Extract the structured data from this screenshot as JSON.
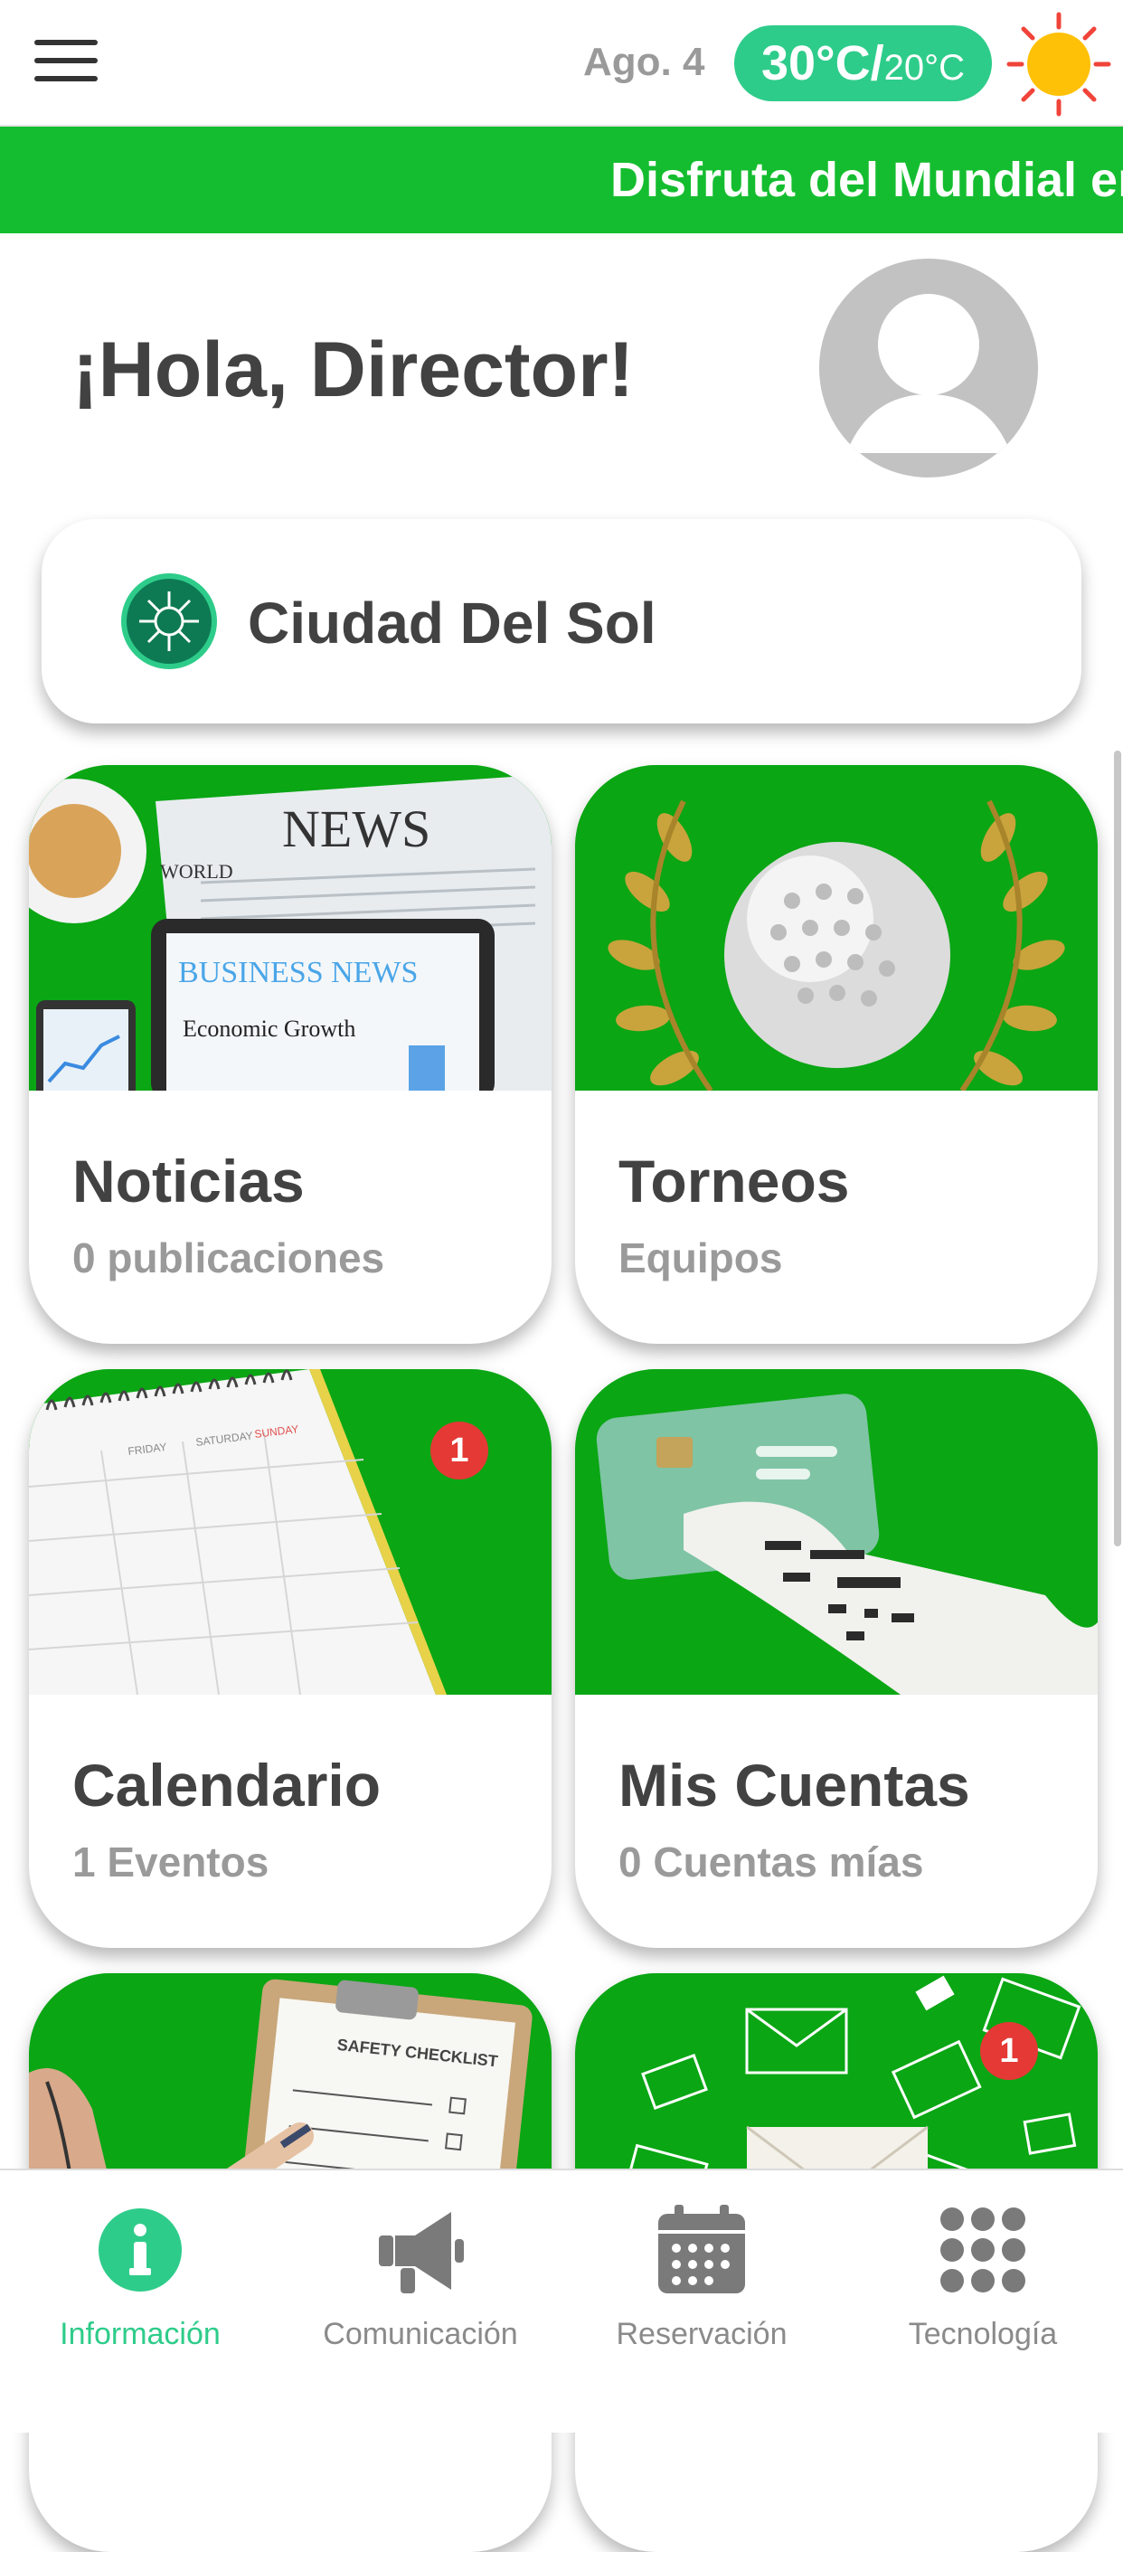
{
  "header": {
    "date": "Ago. 4",
    "temp_high": "30°C/",
    "temp_low": "20°C"
  },
  "ticker": {
    "text": "Disfruta del Mundial en"
  },
  "greeting": "¡Hola, Director!",
  "club": {
    "name": "Ciudad Del Sol"
  },
  "tiles": [
    {
      "title": "Noticias",
      "subtitle": "0 publicaciones",
      "image_text": [
        "NEWS",
        "WORLD",
        "BUSINESS NEWS",
        "Economic Growth"
      ]
    },
    {
      "title": "Torneos",
      "subtitle": "Equipos"
    },
    {
      "title": "Calendario",
      "subtitle": "1 Eventos",
      "badge": "1",
      "image_text": [
        "FRIDAY",
        "SATURDAY",
        "SUNDAY"
      ]
    },
    {
      "title": "Mis Cuentas",
      "subtitle": "0 Cuentas mías"
    },
    {
      "image_text": [
        "SAFETY CHECKLIST"
      ]
    },
    {
      "badge": "1"
    }
  ],
  "nav": [
    {
      "label": "Información",
      "icon": "info-icon",
      "active": true
    },
    {
      "label": "Comunicación",
      "icon": "megaphone-icon"
    },
    {
      "label": "Reservación",
      "icon": "calendar-icon"
    },
    {
      "label": "Tecnología",
      "icon": "apps-grid-icon"
    }
  ],
  "colors": {
    "brand_green": "#14bd2f",
    "accent_teal": "#2ecc8a",
    "badge_red": "#e53935",
    "tile_green": "#0aa614"
  }
}
